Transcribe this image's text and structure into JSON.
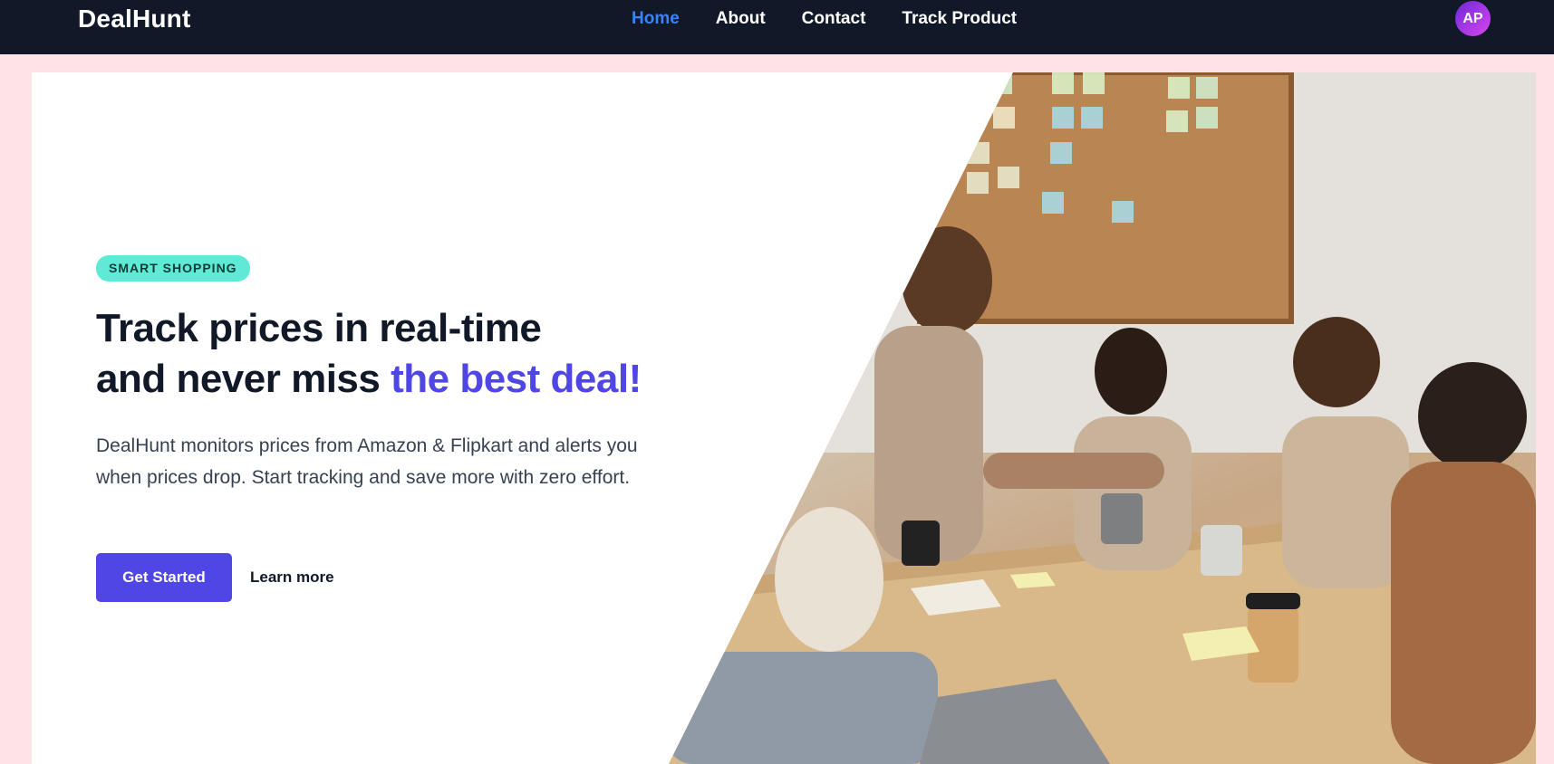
{
  "brand": "DealHunt",
  "nav": {
    "links": [
      "Home",
      "About",
      "Contact",
      "Track Product"
    ],
    "active": "Home"
  },
  "user": {
    "initials": "AP"
  },
  "hero": {
    "badge": "SMART SHOPPING",
    "headline_line1": "Track prices in real-time",
    "headline_line2_prefix": "and never miss ",
    "headline_accent": "the best deal!",
    "description": "DealHunt monitors prices from Amazon & Flipkart and alerts you when prices drop. Start tracking and save more with zero effort.",
    "cta_primary": "Get Started",
    "cta_secondary": "Learn more"
  },
  "colors": {
    "navbar_bg": "#111827",
    "page_bg": "#fde2e7",
    "accent": "#4f46e5",
    "badge_bg": "#5eead4",
    "active_link": "#3b82f6"
  }
}
